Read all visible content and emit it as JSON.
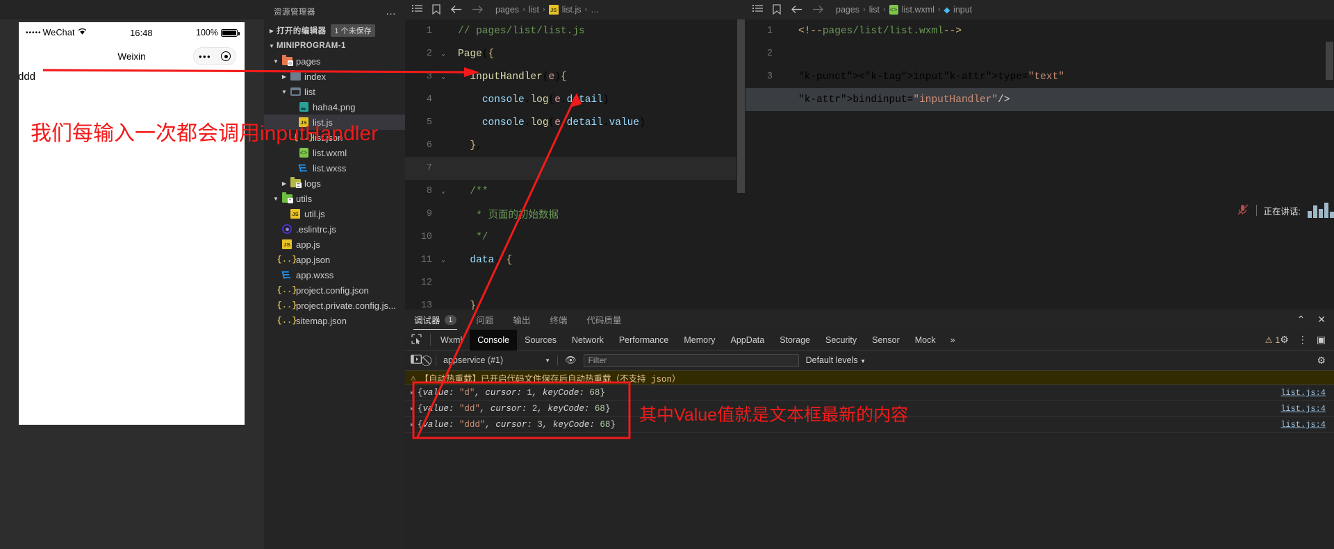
{
  "simulator": {
    "status": {
      "carrier": "WeChat",
      "dots": "•••••",
      "wifi": "≋",
      "time": "16:48",
      "battery": "100%"
    },
    "nav_title": "Weixin",
    "capsule": {
      "dots": "•••",
      "target": "◉"
    },
    "input_value": "ddd"
  },
  "explorer": {
    "title": "资源管理器",
    "more_icon": "…",
    "open_editors": {
      "label": "打开的编辑器",
      "badge": "1 个未保存"
    },
    "project": "MINIPROGRAM-1",
    "tree": [
      {
        "label": "pages",
        "icon": "folder-red",
        "indent": 1,
        "twisty": "▾",
        "selected": false
      },
      {
        "label": "index",
        "icon": "folder-grey",
        "indent": 2,
        "twisty": "▸",
        "selected": false
      },
      {
        "label": "list",
        "icon": "folder-open",
        "indent": 2,
        "twisty": "▾",
        "selected": false
      },
      {
        "label": "haha4.png",
        "icon": "png",
        "indent": 3,
        "twisty": "",
        "selected": false
      },
      {
        "label": "list.js",
        "icon": "js",
        "indent": 3,
        "twisty": "",
        "selected": true
      },
      {
        "label": "list.json",
        "icon": "json",
        "indent": 3,
        "twisty": "",
        "selected": false
      },
      {
        "label": "list.wxml",
        "icon": "wxml",
        "indent": 3,
        "twisty": "",
        "selected": false
      },
      {
        "label": "list.wxss",
        "icon": "wxss",
        "indent": 3,
        "twisty": "",
        "selected": false
      },
      {
        "label": "logs",
        "icon": "folder-olive",
        "indent": 2,
        "twisty": "▸",
        "selected": false
      },
      {
        "label": "utils",
        "icon": "folder-green",
        "indent": 1,
        "twisty": "▾",
        "selected": false
      },
      {
        "label": "util.js",
        "icon": "js",
        "indent": 2,
        "twisty": "",
        "selected": false
      },
      {
        "label": ".eslintrc.js",
        "icon": "eslint",
        "indent": 1,
        "twisty": "",
        "selected": false
      },
      {
        "label": "app.js",
        "icon": "js",
        "indent": 1,
        "twisty": "",
        "selected": false
      },
      {
        "label": "app.json",
        "icon": "json",
        "indent": 1,
        "twisty": "",
        "selected": false
      },
      {
        "label": "app.wxss",
        "icon": "wxss",
        "indent": 1,
        "twisty": "",
        "selected": false
      },
      {
        "label": "project.config.json",
        "icon": "json",
        "indent": 1,
        "twisty": "",
        "selected": false
      },
      {
        "label": "project.private.config.js...",
        "icon": "json",
        "indent": 1,
        "twisty": "",
        "selected": false
      },
      {
        "label": "sitemap.json",
        "icon": "json",
        "indent": 1,
        "twisty": "",
        "selected": false
      }
    ]
  },
  "editor_js": {
    "breadcrumb": {
      "p1": "pages",
      "p2": "list",
      "file": "list.js",
      "tail": "…",
      "sep": "›"
    },
    "icons": {
      "outline": "☰",
      "bookmark": "🔖",
      "back": "←",
      "forward": "→"
    },
    "lines": [
      {
        "n": "1",
        "fold": "",
        "code": "// pages/list/list.js"
      },
      {
        "n": "2",
        "fold": "⌄",
        "code": "Page({"
      },
      {
        "n": "3",
        "fold": "⌄",
        "code": "  inputHandler(e){"
      },
      {
        "n": "4",
        "fold": "",
        "code": "    console.log(e.detail)"
      },
      {
        "n": "5",
        "fold": "",
        "code": "    console.log(e.detail.value)"
      },
      {
        "n": "6",
        "fold": "",
        "code": "  },"
      },
      {
        "n": "7",
        "fold": "",
        "code": ""
      },
      {
        "n": "8",
        "fold": "⌄",
        "code": "  /**"
      },
      {
        "n": "9",
        "fold": "",
        "code": "   * 页面的初始数据"
      },
      {
        "n": "10",
        "fold": "",
        "code": "   */"
      },
      {
        "n": "11",
        "fold": "⌄",
        "code": "  data: {"
      },
      {
        "n": "12",
        "fold": "",
        "code": ""
      },
      {
        "n": "13",
        "fold": "",
        "code": "  },"
      }
    ]
  },
  "editor_wxml": {
    "breadcrumb": {
      "p1": "pages",
      "p2": "list",
      "file": "list.wxml",
      "tail": "input",
      "sep": "›"
    },
    "lines": [
      {
        "n": "1",
        "code": "<!--pages/list/list.wxml-->"
      },
      {
        "n": "2",
        "code": ""
      },
      {
        "n": "3",
        "code": "<input type=\"text\""
      },
      {
        "n": "",
        "code": "bindinput=\"inputHandler\"/>"
      }
    ]
  },
  "devtools": {
    "tabs": [
      {
        "label": "调试器",
        "count": "1",
        "active": true
      },
      {
        "label": "问题",
        "count": "",
        "active": false
      },
      {
        "label": "输出",
        "count": "",
        "active": false
      },
      {
        "label": "终端",
        "count": "",
        "active": false
      },
      {
        "label": "代码质量",
        "count": "",
        "active": false
      }
    ],
    "panel_actions": {
      "collapse": "⌃",
      "close": "✕"
    },
    "devtool_tabs": [
      "Wxml",
      "Console",
      "Sources",
      "Network",
      "Performance",
      "Memory",
      "AppData",
      "Storage",
      "Security",
      "Sensor",
      "Mock"
    ],
    "active_devtool_tab": "Console",
    "overflow": "»",
    "warning_count": "1",
    "right_icons": {
      "settings": "⚙",
      "menu": "⋮",
      "dock": "▣"
    },
    "toolbar": {
      "context": "appservice (#1)",
      "filter_placeholder": "Filter",
      "levels": "Default levels",
      "eye_icon": "◉",
      "clear_icon": "⃠",
      "sidebar_icon": "▷|",
      "settings_icon": "⚙"
    },
    "warning_message": "【自动热重载】已开启代码文件保存后自动热重载（不支持 json）",
    "console_rows": [
      {
        "prefix": "{",
        "key": "value: ",
        "str": "\"d\"",
        "mid": ", cursor: ",
        "num": "1",
        "tail": ", keyCode: ",
        "num2": "68",
        "close": "}",
        "source": "list.js:4"
      },
      {
        "prefix": "{",
        "key": "value: ",
        "str": "\"dd\"",
        "mid": ", cursor: ",
        "num": "2",
        "tail": ", keyCode: ",
        "num2": "68",
        "close": "}",
        "source": "list.js:4"
      },
      {
        "prefix": "{",
        "key": "value: ",
        "str": "\"ddd\"",
        "mid": ", cursor: ",
        "num": "3",
        "tail": ", keyCode: ",
        "num2": "68",
        "close": "}",
        "source": "list.js:4"
      }
    ]
  },
  "annotations": {
    "note1": "我们每输入一次都会调用inputHandler",
    "note2": "其中Value值就是文本框最新的内容",
    "color": "#f21a1a"
  },
  "toast": {
    "mic": "🎤",
    "text": "正在讲话:"
  }
}
